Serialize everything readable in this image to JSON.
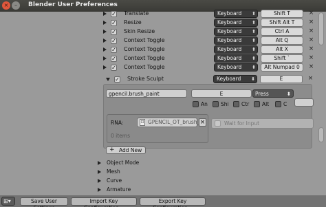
{
  "window": {
    "title": "Blender User Preferences",
    "close_glyph": "×",
    "min_glyph": "–"
  },
  "keymap_rows": [
    {
      "label": "Translate",
      "device": "Keyboard",
      "key": "Shift T",
      "enabled": true
    },
    {
      "label": "Resize",
      "device": "Keyboard",
      "key": "Shift Alt T",
      "enabled": true
    },
    {
      "label": "Skin Resize",
      "device": "Keyboard",
      "key": "Ctrl A",
      "enabled": true
    },
    {
      "label": "Context Toggle",
      "device": "Keyboard",
      "key": "Alt Q",
      "enabled": true
    },
    {
      "label": "Context Toggle",
      "device": "Keyboard",
      "key": "Alt X",
      "enabled": true
    },
    {
      "label": "Context Toggle",
      "device": "Keyboard",
      "key": "Shift `",
      "enabled": true
    },
    {
      "label": "Context Toggle",
      "device": "Keyboard",
      "key": "Alt Numpad 0",
      "enabled": true
    },
    {
      "label": "Stroke Sculpt",
      "device": "Keyboard",
      "key": "E",
      "enabled": true,
      "expanded": true
    }
  ],
  "expanded_item": {
    "operator_id": "gpencil.brush_paint",
    "key": "E",
    "value_mode": "Press",
    "modifiers": [
      "An",
      "Shi",
      "Ctr",
      "Alt",
      "C"
    ],
    "rna_label": "RNA:",
    "rna_value": "GPENCIL_OT_brush_",
    "wait_for_input": "Wait for Input",
    "items_count": "0 items"
  },
  "add_new_label": "Add New",
  "categories": [
    "Object Mode",
    "Mesh",
    "Curve",
    "Armature"
  ],
  "footer": {
    "save": "Save User Settings",
    "import": "Import Key Configuration...",
    "export": "Export Key Configuration..."
  },
  "colors": {
    "background": "#9a9a9a",
    "dropdown": "#3a3a3a",
    "titlebar": "#3f3f3b",
    "close_button": "#e0573c"
  },
  "icons": [
    "close-icon",
    "minimize-icon",
    "disclosure-triangle-icon",
    "checkbox-icon",
    "dropdown-arrow-icon",
    "remove-x-icon",
    "plus-icon",
    "editor-type-icon",
    "image-icon"
  ]
}
